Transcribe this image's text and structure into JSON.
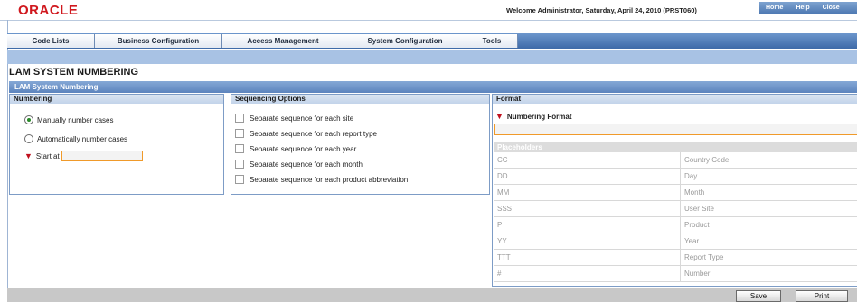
{
  "header": {
    "logo": "ORACLE",
    "welcome": "Welcome Administrator, Saturday, April 24, 2010 (PRST060)",
    "links": [
      "Home",
      "Help",
      "Close"
    ]
  },
  "nav": {
    "tabs": [
      "Code Lists",
      "Business Configuration",
      "Access Management",
      "System Configuration",
      "Tools"
    ]
  },
  "page": {
    "title": "LAM SYSTEM NUMBERING",
    "section": "LAM System Numbering"
  },
  "numbering": {
    "heading": "Numbering",
    "manual_label": "Manually number cases",
    "auto_label": "Automatically number cases",
    "start_label": "Start at",
    "start_value": ""
  },
  "sequencing": {
    "heading": "Sequencing Options",
    "options": [
      "Separate sequence for each site",
      "Separate sequence for each report type",
      "Separate sequence for each year",
      "Separate sequence for each month",
      "Separate sequence for each product abbreviation"
    ]
  },
  "format": {
    "heading": "Format",
    "numbering_format_label": "Numbering Format",
    "numbering_format_value": "",
    "placeholders_heading": "Placeholders",
    "placeholders": [
      {
        "code": "CC",
        "desc": "Country Code"
      },
      {
        "code": "DD",
        "desc": "Day"
      },
      {
        "code": "MM",
        "desc": "Month"
      },
      {
        "code": "SSS",
        "desc": "User Site"
      },
      {
        "code": "P",
        "desc": "Product"
      },
      {
        "code": "YY",
        "desc": "Year"
      },
      {
        "code": "TTT",
        "desc": "Report Type"
      },
      {
        "code": "#",
        "desc": "Number"
      }
    ]
  },
  "footer": {
    "save_label": "Save",
    "print_label": "Print"
  },
  "colors": {
    "brand_red": "#d0181e",
    "nav_blue": "#3e6aa8",
    "required_marker": "#c0101e",
    "input_border": "#f09a2a"
  }
}
